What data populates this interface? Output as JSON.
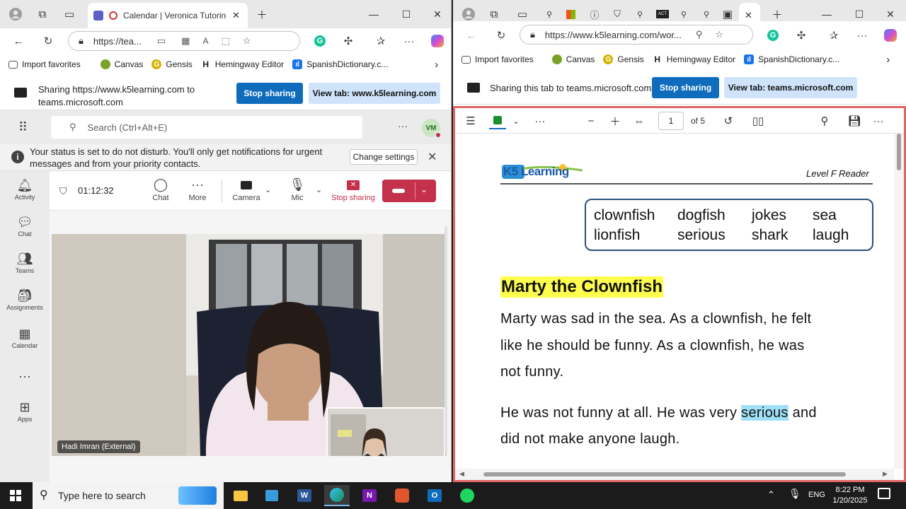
{
  "left_browser": {
    "tab_title": "Calendar | Veronica Tutoring",
    "url": "https://tea...",
    "favorites": [
      "Import favorites",
      "Canvas",
      "Gensis",
      "Hemingway Editor",
      "SpanishDictionary.c..."
    ],
    "sharing": {
      "text": "Sharing https://www.k5learning.com to teams.microsoft.com",
      "stop_label": "Stop sharing",
      "view_label": "View tab: www.k5learning.com"
    }
  },
  "teams": {
    "search_placeholder": "Search (Ctrl+Alt+E)",
    "avatar_initials": "VM",
    "notice_text": "Your status is set to do not disturb. You'll only get notifications for urgent messages and from your priority contacts.",
    "change_settings_label": "Change settings",
    "rail": [
      "Activity",
      "Chat",
      "Teams",
      "Assignments",
      "Calendar",
      "Apps"
    ],
    "call": {
      "timer": "01:12:32",
      "chat_label": "Chat",
      "more_label": "More",
      "camera_label": "Camera",
      "mic_label": "Mic",
      "stop_sharing_label": "Stop sharing"
    },
    "participant_name": "Hadi Imran (External)"
  },
  "right_browser": {
    "url": "https://www.k5learning.com/wor...",
    "favorites": [
      "Import favorites",
      "Canvas",
      "Gensis",
      "Hemingway Editor",
      "SpanishDictionary.c..."
    ],
    "sharing": {
      "text": "Sharing this tab to teams.microsoft.com",
      "stop_label": "Stop sharing",
      "view_label": "View tab: teams.microsoft.com"
    },
    "pdf": {
      "page_number": "1",
      "page_total": "of 5"
    }
  },
  "worksheet": {
    "logo": "K5 Learning",
    "level": "Level F Reader",
    "words_row1": [
      "clownfish",
      "dogfish",
      "jokes",
      "sea"
    ],
    "words_row2": [
      "lionfish",
      "serious",
      "shark",
      "laugh"
    ],
    "title": "Marty the Clownfish",
    "p1_lines": [
      "Marty was sad in the sea. As a clownfish, he felt",
      "like he should be funny. As a clownfish, he was",
      "not funny."
    ],
    "p2_line1_before": "He was not funny at all. He was very ",
    "p2_highlight": "serious",
    "p2_line1_after": " and",
    "p2_line2": "did not make anyone laugh."
  },
  "taskbar": {
    "search_placeholder": "Type here to search",
    "language": "ENG",
    "time": "8:22 PM",
    "date": "1/20/2025"
  },
  "colors": {
    "accent_blue": "#0f6cbd",
    "end_call_red": "#c4314b",
    "title_highlight": "#ffff4d",
    "word_highlight": "#9fe0f7",
    "share_border": "#e06666"
  }
}
